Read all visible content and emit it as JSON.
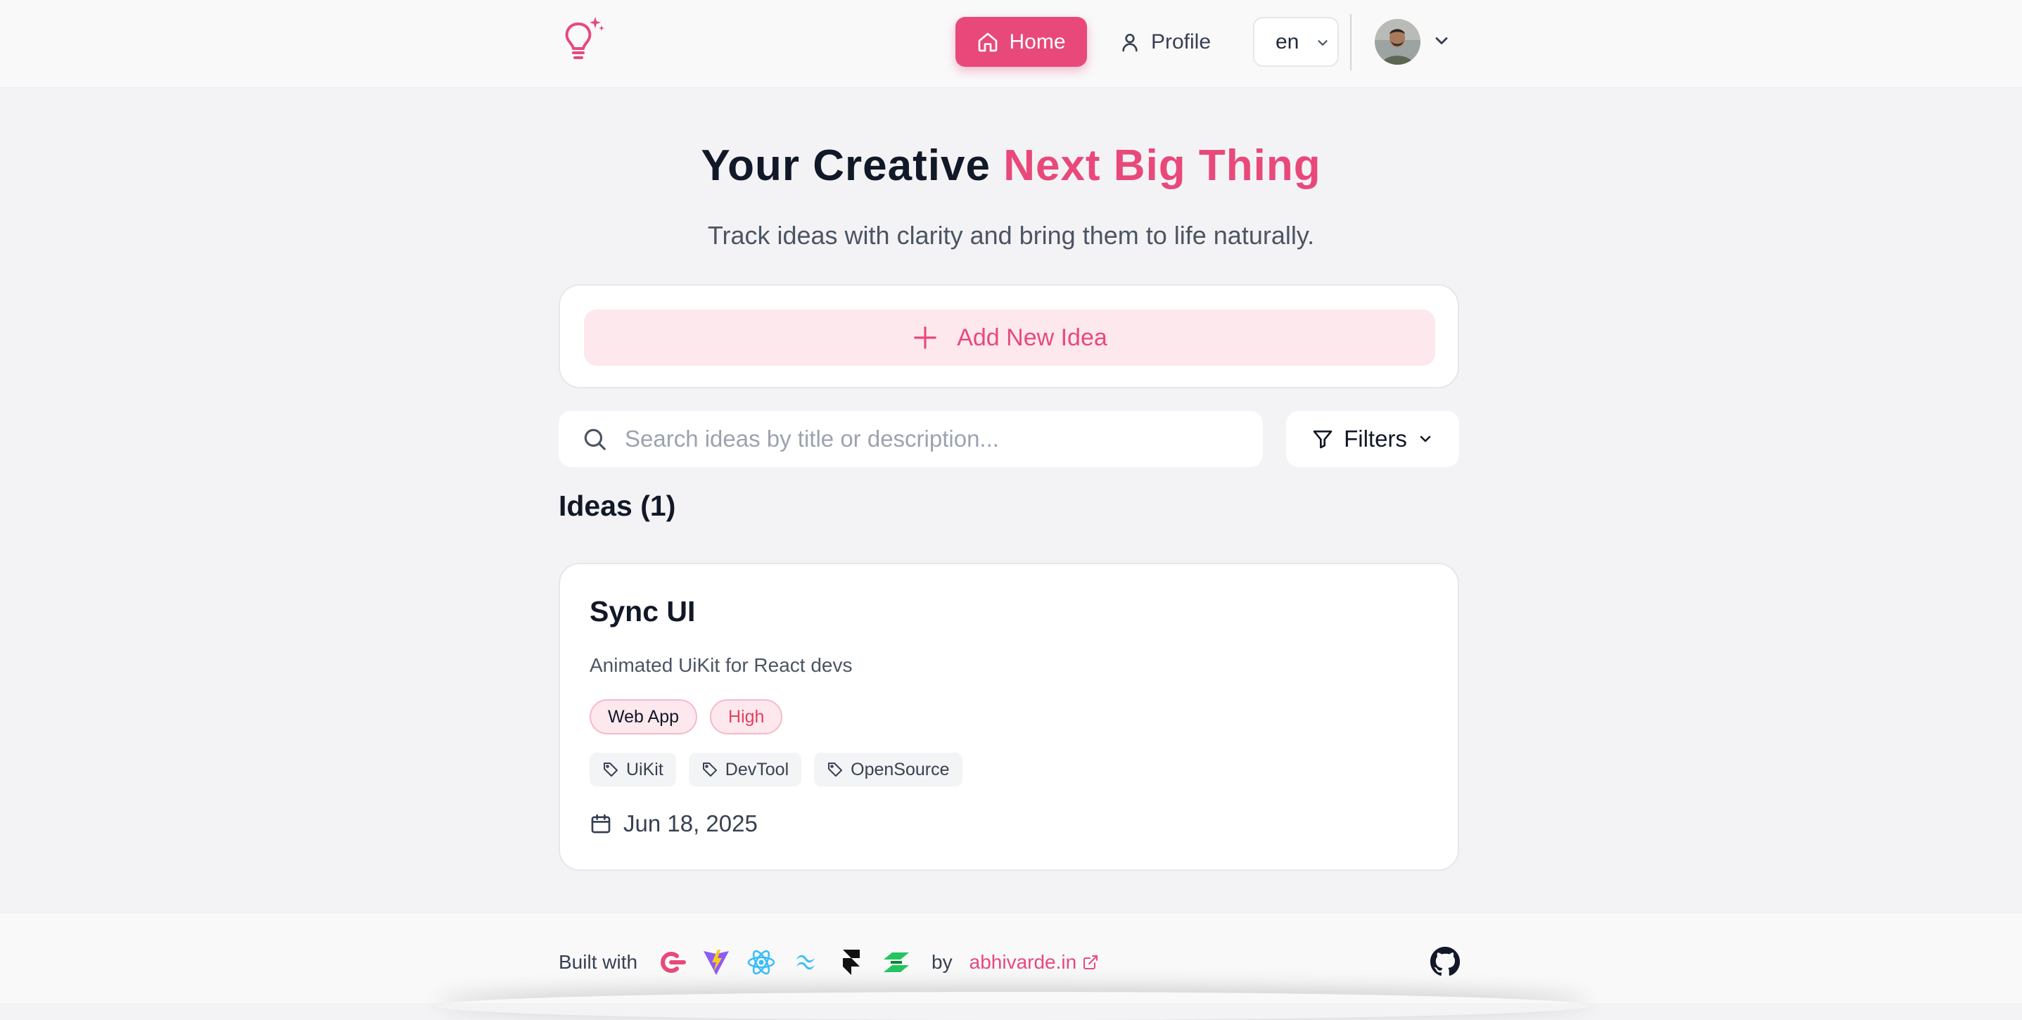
{
  "nav": {
    "home_label": "Home",
    "profile_label": "Profile",
    "language": "en"
  },
  "hero": {
    "title_main": "Your Creative",
    "title_accent": "Next Big Thing",
    "subtitle": "Track ideas with clarity and bring them to life naturally."
  },
  "add_idea": {
    "label": "Add New Idea"
  },
  "search": {
    "placeholder": "Search ideas by title or description...",
    "value": ""
  },
  "filters": {
    "label": "Filters"
  },
  "ideas": {
    "heading": "Ideas (1)",
    "items": [
      {
        "title": "Sync UI",
        "description": "Animated UiKit for React devs",
        "category": "Web App",
        "priority": "High",
        "tags": [
          "UiKit",
          "DevTool",
          "OpenSource"
        ],
        "date": "Jun 18, 2025"
      }
    ]
  },
  "footer": {
    "built_with": "Built with",
    "by": "by",
    "link_text": "abhivarde.in",
    "tech_icons": [
      "appwrite-icon",
      "vite-icon",
      "react-icon",
      "tailwind-icon",
      "framer-icon",
      "shadcn-icon"
    ]
  },
  "colors": {
    "accent": "#e8497a",
    "background": "#f3f3f5",
    "card": "#ffffff"
  }
}
